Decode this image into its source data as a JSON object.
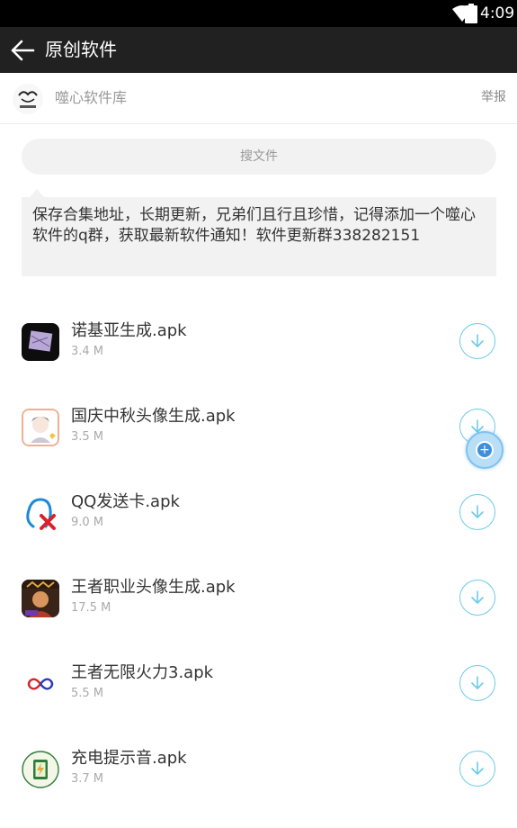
{
  "status_bar": {
    "time": "4:09",
    "icons": [
      "wifi-icon",
      "battery-icon"
    ]
  },
  "app_bar": {
    "title": "原创软件",
    "back_icon": "arrow-left-icon"
  },
  "owner": {
    "name": "噬心软件库",
    "report_label": "举报"
  },
  "search": {
    "placeholder": "搜文件"
  },
  "notice": {
    "text": "保存合集地址，长期更新，兄弟们且行且珍惜，记得添加一个噬心软件的q群，获取最新软件通知！软件更新群338282151"
  },
  "files": [
    {
      "name": "诺基亚生成.apk",
      "size": "3.4 M",
      "icon": "nokia-app-icon"
    },
    {
      "name": "国庆中秋头像生成.apk",
      "size": "3.5 M",
      "icon": "avatar-app-icon"
    },
    {
      "name": "QQ发送卡.apk",
      "size": "9.0 M",
      "icon": "qq-app-icon"
    },
    {
      "name": "王者职业头像生成.apk",
      "size": "17.5 M",
      "icon": "game-avatar-app-icon"
    },
    {
      "name": "王者无限火力3.apk",
      "size": "5.5 M",
      "icon": "infinity-app-icon"
    },
    {
      "name": "充电提示音.apk",
      "size": "3.7 M",
      "icon": "charge-app-icon"
    }
  ],
  "colors": {
    "app_bar": "#212121",
    "accent": "#6ccbe8",
    "float_button": "#3f8fdc"
  }
}
